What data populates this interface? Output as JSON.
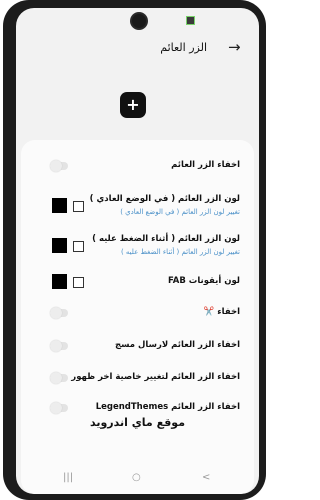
{
  "header": {
    "back_icon": "arrow-right",
    "title": "الزر العائم"
  },
  "fab": {
    "icon": "plus",
    "glyph": "+"
  },
  "settings": {
    "hide_fab": {
      "label": "اخفاء الزر العائم"
    },
    "fab_color_normal": {
      "label": "لون الزر العائم ( في الوضع العادي )",
      "description": "تغيير لون الزر العائم ( في الوضع العادي )",
      "color": "#000000"
    },
    "fab_color_pressed": {
      "label": "لون الزر العائم ( أثناء الضغط عليه )",
      "description": "تغيير لون الزر العائم ( أثناء الضغط عليه )",
      "color": "#000000"
    },
    "fab_icons_color": {
      "label": "لون أيقونات FAB",
      "color": "#000000"
    },
    "hide_scissors": {
      "label": "اخفاء ✂️"
    },
    "hide_fab_broadcast": {
      "label": "اخفاء الزر العائم لارسال مسج"
    },
    "hide_fab_last_seen": {
      "label": "اخفاء الزر العائم لتغيير خاصية اخر ظهور"
    },
    "hide_fab_legendthemes": {
      "label": "اخفاء الزر العائم LegendThemes"
    }
  },
  "footer": {
    "watermark": "موقع ماي اندرويد"
  },
  "navbar": {
    "recents_glyph": "|||",
    "home_glyph": "○",
    "back_glyph": "<"
  }
}
